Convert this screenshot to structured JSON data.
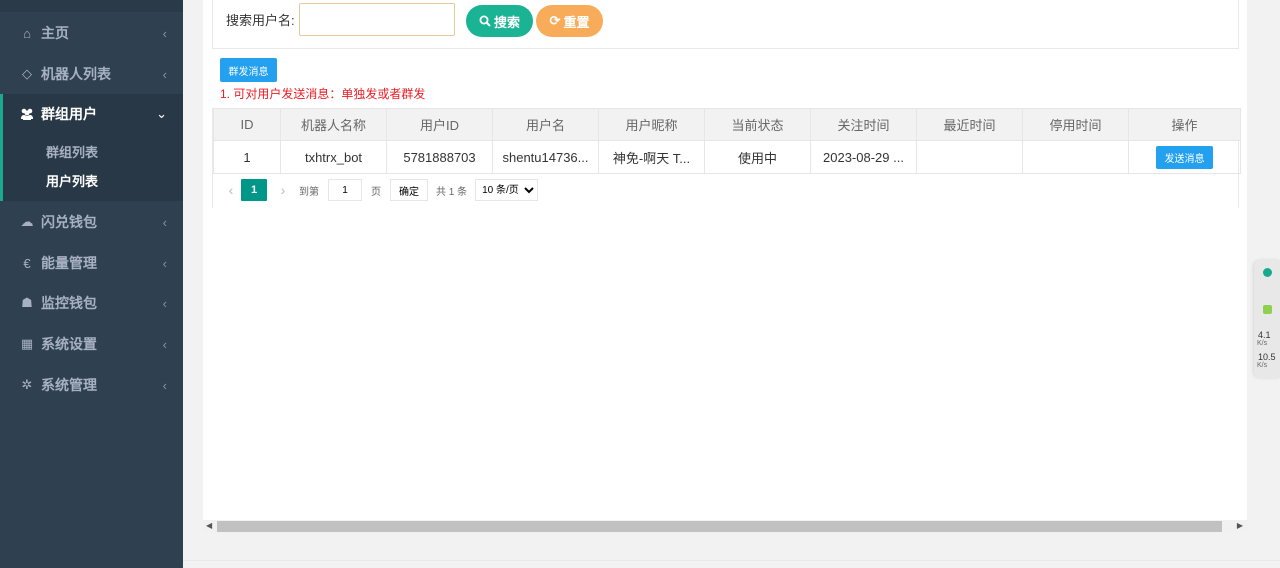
{
  "sidebar": {
    "items": [
      {
        "label": "主页",
        "icon": "home-icon",
        "glyph": "⌂"
      },
      {
        "label": "机器人列表",
        "icon": "diamond-icon",
        "glyph": "◇"
      },
      {
        "label": "群组用户",
        "icon": "users-icon",
        "glyph": "👥"
      },
      {
        "label": "闪兑钱包",
        "icon": "cloud-icon",
        "glyph": "☁"
      },
      {
        "label": "能量管理",
        "icon": "euro-icon",
        "glyph": "€"
      },
      {
        "label": "监控钱包",
        "icon": "shield-icon",
        "glyph": "☗"
      },
      {
        "label": "系统设置",
        "icon": "windows-icon",
        "glyph": "▦"
      },
      {
        "label": "系统管理",
        "icon": "gear-icon",
        "glyph": "✲"
      }
    ],
    "sub_items": [
      {
        "label": "群组列表"
      },
      {
        "label": "用户列表"
      }
    ],
    "chevron_glyph": "‹",
    "chevron_down_glyph": "⌄"
  },
  "search": {
    "label": "搜索用户名:",
    "value": "",
    "placeholder": "",
    "search_label": "搜索",
    "reset_label": "重置",
    "search_glyph": "🔍",
    "reset_glyph": "⟳"
  },
  "actions": {
    "mass_send_label": "群发消息",
    "notice": "1. 可对用户发送消息：单独发或者群发"
  },
  "table": {
    "columns": [
      "ID",
      "机器人名称",
      "用户ID",
      "用户名",
      "用户昵称",
      "当前状态",
      "关注时间",
      "最近时间",
      "停用时间",
      "操作"
    ],
    "rows": [
      {
        "id": "1",
        "bot_name": "txhtrx_bot",
        "user_id": "5781888703",
        "username": "shentu14736...",
        "nickname": "神免-啊天 T...",
        "status": "使用中",
        "follow_time": "2023-08-29 ...",
        "last_time": "",
        "disabled_time": "",
        "action_label": "发送消息"
      }
    ]
  },
  "pager": {
    "prev": "‹",
    "next": "›",
    "current_page": "1",
    "goto_label": "到第",
    "goto_value": "1",
    "page_unit": "页",
    "confirm_label": "确定",
    "total_label": "共 1 条",
    "page_size_selected": "10 条/页"
  },
  "speed_widget": {
    "upload_value": "4.1",
    "upload_unit": "K/s",
    "download_value": "10.5",
    "download_unit": "K/s"
  },
  "colors": {
    "sidebar_bg": "#2f4050",
    "accent_green": "#1ab394",
    "accent_orange": "#f8ac59",
    "accent_blue": "#23a0f0",
    "page_current": "#009688",
    "notice_red": "#ed1c24"
  }
}
